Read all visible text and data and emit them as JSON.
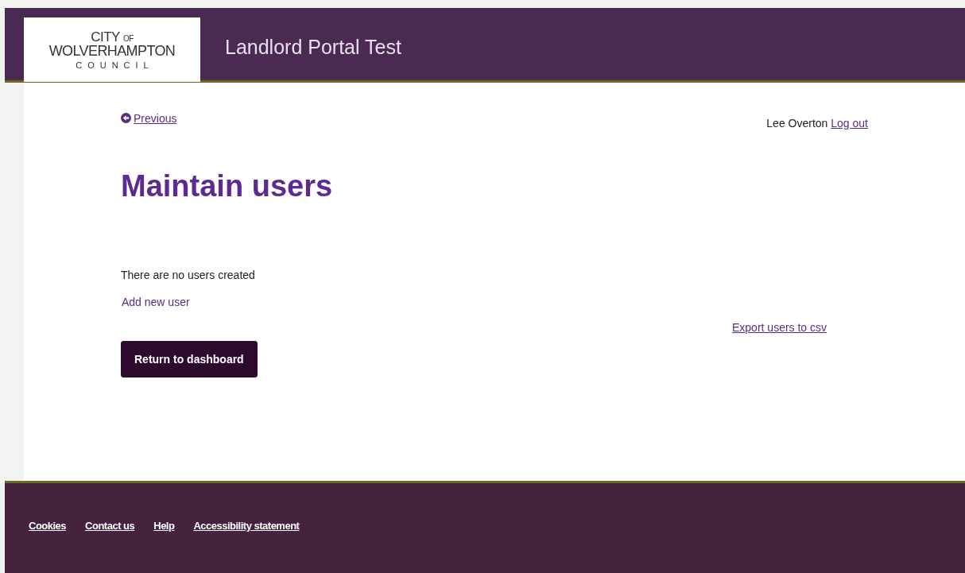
{
  "header": {
    "logo": {
      "line_1": "CITY",
      "line_1_small": "OF",
      "line_2": "WOLVERHAMPTON",
      "line_3": "COUNCIL"
    },
    "title": "Landlord Portal Test"
  },
  "previous_link": "Previous",
  "user": {
    "name": "Lee Overton",
    "logout_link": "Log out"
  },
  "heading": "Maintain users",
  "message": "There are no users created",
  "add_link": "Add new user",
  "export_link": "Export users to csv",
  "return_button": "Return to dashboard",
  "footer": {
    "links": [
      "Cookies",
      "Contact us",
      "Help",
      "Accessibility statement"
    ]
  }
}
